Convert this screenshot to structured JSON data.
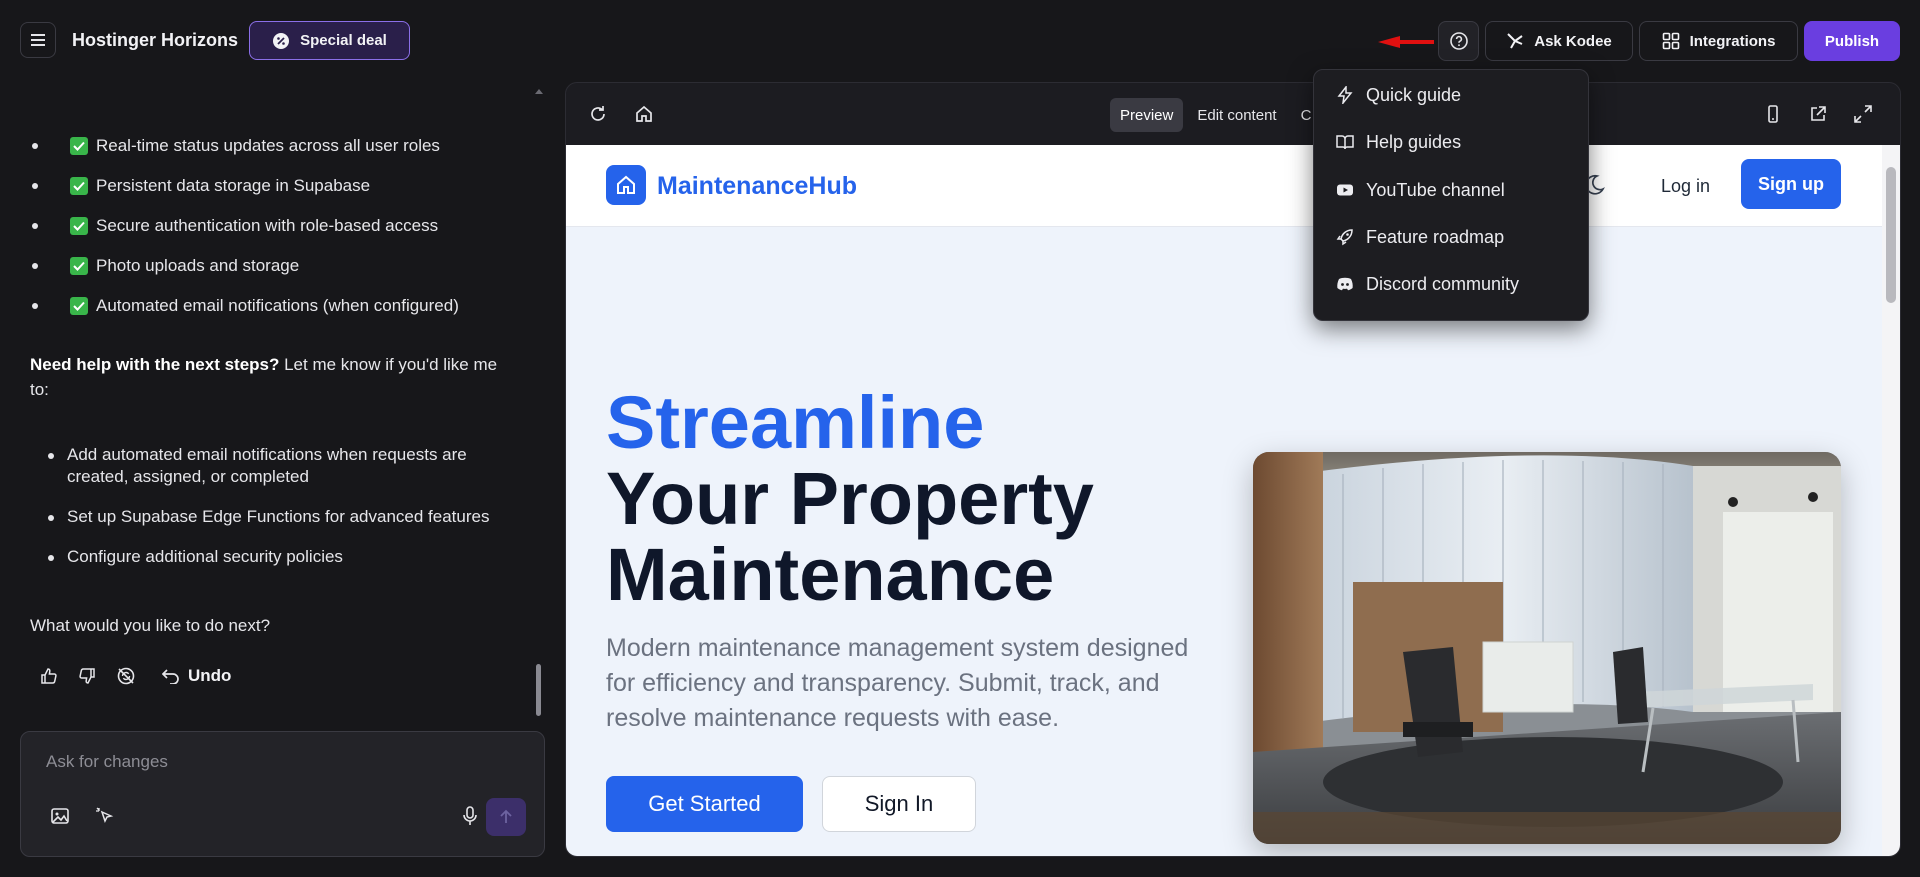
{
  "header": {
    "app_title": "Hostinger Horizons",
    "special_deal": "Special deal",
    "ask_kodee": "Ask Kodee",
    "integrations": "Integrations",
    "publish": "Publish"
  },
  "chat": {
    "features": [
      "Real-time status updates across all user roles",
      "Persistent data storage in Supabase",
      "Secure authentication with role-based access",
      "Photo uploads and storage",
      "Automated email notifications (when configured)"
    ],
    "help_bold": "Need help with the next steps?",
    "help_text": " Let me know if you'd like me to:",
    "next_steps": [
      "Add automated email notifications when requests are created, assigned, or completed",
      "Set up Supabase Edge Functions for advanced features",
      "Configure additional security policies"
    ],
    "question": "What would you like to do next?",
    "undo": "Undo",
    "input_placeholder": "Ask for changes"
  },
  "preview": {
    "tabs": [
      "Preview",
      "Edit content",
      "C"
    ]
  },
  "help_menu": {
    "items": [
      "Quick guide",
      "Help guides",
      "YouTube channel",
      "Feature roadmap",
      "Discord community"
    ]
  },
  "site": {
    "logo": "MaintenanceHub",
    "login": "Log in",
    "signup": "Sign up",
    "hero_line1": "Streamline",
    "hero_line2": "Your Property",
    "hero_line3": "Maintenance",
    "hero_sub": "Modern maintenance management system designed for efficiency and transparency. Submit, track, and resolve maintenance requests with ease.",
    "get_started": "Get Started",
    "sign_in": "Sign In"
  },
  "colors": {
    "accent": "#6a3ee0",
    "site_blue": "#2563eb",
    "check_green": "#39b54a",
    "arrow_red": "#e01010"
  }
}
